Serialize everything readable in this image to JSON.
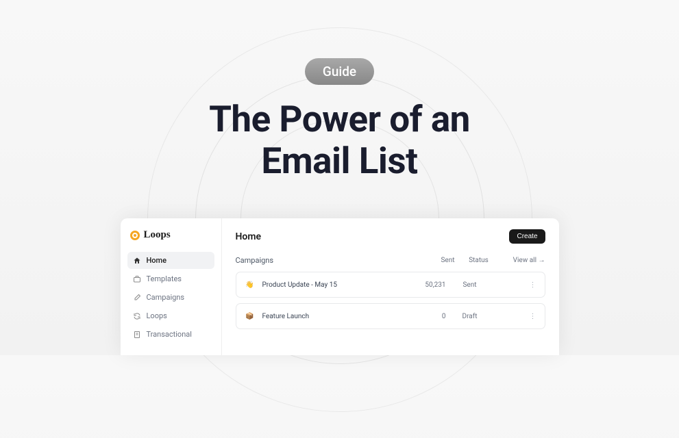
{
  "header": {
    "badge": "Guide",
    "title_line1": "The Power of an",
    "title_line2": "Email List"
  },
  "app": {
    "brand": "Loops",
    "sidebar": {
      "items": [
        {
          "label": "Home",
          "icon": "home"
        },
        {
          "label": "Templates",
          "icon": "briefcase"
        },
        {
          "label": "Campaigns",
          "icon": "edit"
        },
        {
          "label": "Loops",
          "icon": "refresh"
        },
        {
          "label": "Transactional",
          "icon": "receipt"
        }
      ]
    },
    "main": {
      "title": "Home",
      "create_label": "Create",
      "section_title": "Campaigns",
      "col_sent": "Sent",
      "col_status": "Status",
      "view_all": "View all →",
      "rows": [
        {
          "emoji": "👋",
          "name": "Product Update - May 15",
          "sent": "50,231",
          "status": "Sent"
        },
        {
          "emoji": "📦",
          "name": "Feature Launch",
          "sent": "0",
          "status": "Draft"
        }
      ]
    }
  }
}
